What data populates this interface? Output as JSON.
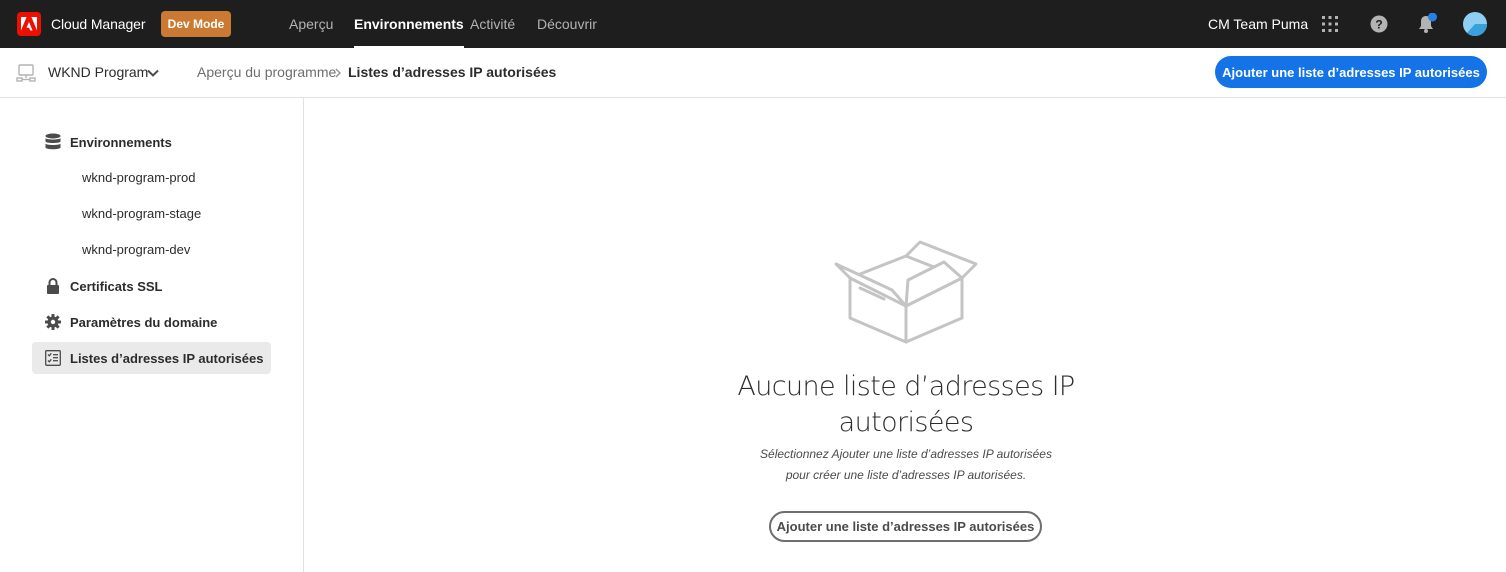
{
  "topbar": {
    "app_title": "Cloud Manager",
    "dev_badge": "Dev Mode",
    "nav": [
      {
        "label": "Aperçu",
        "active": false
      },
      {
        "label": "Environnements",
        "active": true
      },
      {
        "label": "Activité",
        "active": false
      },
      {
        "label": "Découvrir",
        "active": false
      }
    ],
    "team_name": "CM Team Puma",
    "icons": [
      "apps-grid-icon",
      "help-icon",
      "notification-bell-icon",
      "user-avatar-icon"
    ],
    "notification_dot_color": "#2680eb"
  },
  "subbar": {
    "program_name": "WKND Program",
    "breadcrumb": [
      "Aperçu du programme",
      "Listes d’adresses IP autorisées"
    ],
    "primary_action": "Ajouter une liste d’adresses IP autorisées"
  },
  "sidebar": {
    "environments_label": "Environnements",
    "environments": [
      "wknd-program-prod",
      "wknd-program-stage",
      "wknd-program-dev"
    ],
    "ssl_label": "Certificats SSL",
    "domain_label": "Paramètres du domaine",
    "ip_list_label": "Listes d’adresses IP autorisées"
  },
  "empty_state": {
    "title_line1": "Aucune liste d’adresses IP",
    "title_line2": "autorisées",
    "desc_line1": "Sélectionnez Ajouter une liste d’adresses IP autorisées",
    "desc_line2": "pour créer une liste d’adresses IP autorisées.",
    "button": "Ajouter une liste d’adresses IP autorisées",
    "illustration": "empty-box-icon"
  },
  "colors": {
    "brand_red": "#eb1000",
    "dev_badge": "#cb7a33",
    "primary_blue": "#1473e6",
    "topbar_bg": "#1e1e1e"
  }
}
